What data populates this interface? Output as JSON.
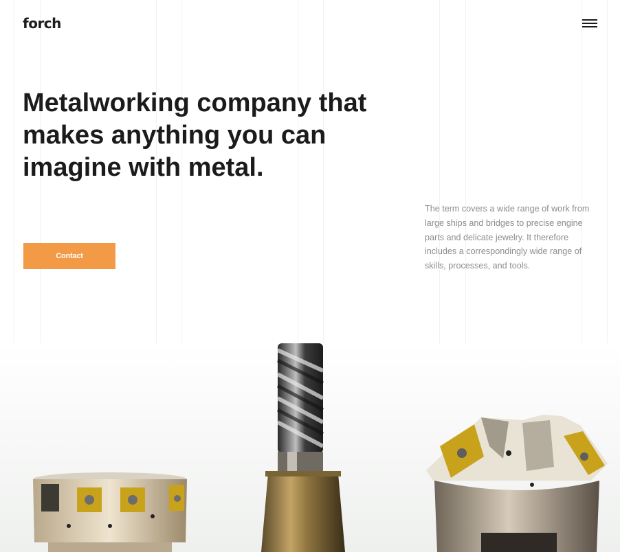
{
  "header": {
    "logo_text": "forch",
    "menu_icon": "hamburger-menu-icon"
  },
  "hero": {
    "headline": "Metalworking company that makes anything you can imagine with metal.",
    "cta_label": "Contact",
    "description": "The term covers a wide range of work from large ships and bridges to precise engine parts and delicate jewelry. It therefore includes a correspondingly wide range of skills, processes, and tools."
  },
  "colors": {
    "accent": "#f39a47",
    "text": "#1b1b1b",
    "muted_text": "#8c8c8c",
    "background": "#ffffff"
  },
  "image": {
    "subject": "milling-cutters-photo"
  }
}
